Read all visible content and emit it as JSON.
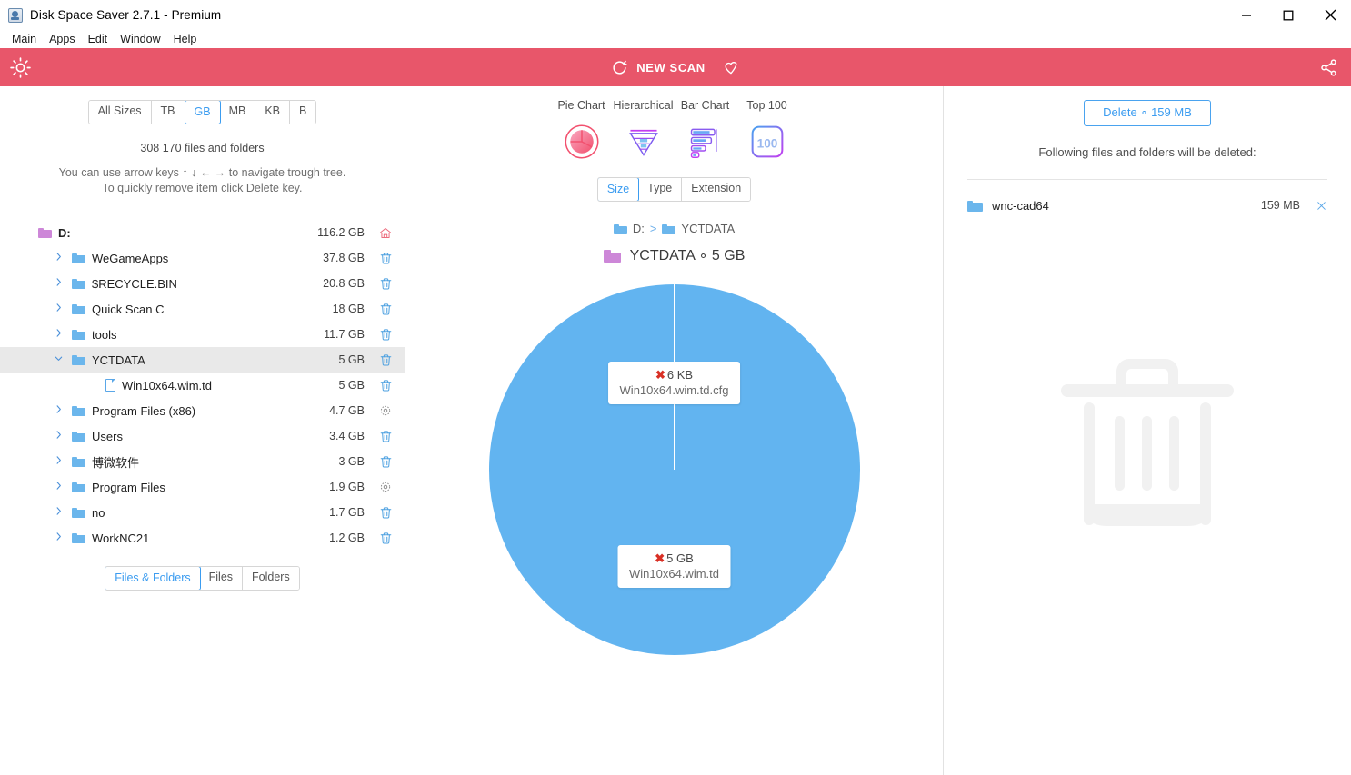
{
  "window": {
    "title": "Disk Space Saver 2.7.1 - Premium",
    "app_icon": "disk-icon",
    "minimize": "minimize-icon",
    "maximize": "maximize-icon",
    "close": "close-icon"
  },
  "menubar": {
    "items": [
      "Main",
      "Apps",
      "Edit",
      "Window",
      "Help"
    ]
  },
  "toolbar": {
    "brightness_icon": "sun-icon",
    "new_scan_label": "NEW SCAN",
    "refresh_icon": "refresh-icon",
    "favorite_icon": "heart-icon",
    "share_icon": "share-icon",
    "bg_color": "#e8566a"
  },
  "left_panel": {
    "size_filter": {
      "options": [
        "All Sizes",
        "TB",
        "GB",
        "MB",
        "KB",
        "B"
      ],
      "selected": "GB"
    },
    "file_count": "308 170 files and folders",
    "hint_line1": "You can use arrow keys ↑ ↓ ← → to navigate trough tree.",
    "hint_line2": "To quickly remove item click Delete key.",
    "tree": [
      {
        "name": "D:",
        "size": "116.2 GB",
        "indent": 0,
        "chevron": "",
        "icon": "folder-purple",
        "action": "home-icon",
        "bold": true,
        "selected": false
      },
      {
        "name": "WeGameApps",
        "size": "37.8 GB",
        "indent": 1,
        "chevron": ">",
        "icon": "folder-blue",
        "action": "trash-icon",
        "bold": false,
        "selected": false
      },
      {
        "name": "$RECYCLE.BIN",
        "size": "20.8 GB",
        "indent": 1,
        "chevron": ">",
        "icon": "folder-blue",
        "action": "trash-icon",
        "bold": false,
        "selected": false
      },
      {
        "name": "Quick Scan C",
        "size": "18 GB",
        "indent": 1,
        "chevron": ">",
        "icon": "folder-blue",
        "action": "trash-icon",
        "bold": false,
        "selected": false
      },
      {
        "name": "tools",
        "size": "11.7 GB",
        "indent": 1,
        "chevron": ">",
        "icon": "folder-blue",
        "action": "trash-icon",
        "bold": false,
        "selected": false
      },
      {
        "name": "YCTDATA",
        "size": "5 GB",
        "indent": 1,
        "chevron": "v",
        "icon": "folder-blue",
        "action": "trash-icon",
        "bold": false,
        "selected": true
      },
      {
        "name": "Win10x64.wim.td",
        "size": "5 GB",
        "indent": 2,
        "chevron": "",
        "icon": "file",
        "action": "trash-icon",
        "bold": false,
        "selected": false
      },
      {
        "name": "Program Files (x86)",
        "size": "4.7 GB",
        "indent": 1,
        "chevron": ">",
        "icon": "folder-blue",
        "action": "gear-icon",
        "bold": false,
        "selected": false
      },
      {
        "name": "Users",
        "size": "3.4 GB",
        "indent": 1,
        "chevron": ">",
        "icon": "folder-blue",
        "action": "trash-icon",
        "bold": false,
        "selected": false
      },
      {
        "name": "博微软件",
        "size": "3 GB",
        "indent": 1,
        "chevron": ">",
        "icon": "folder-blue",
        "action": "trash-icon",
        "bold": false,
        "selected": false
      },
      {
        "name": "Program Files",
        "size": "1.9 GB",
        "indent": 1,
        "chevron": ">",
        "icon": "folder-blue",
        "action": "gear-icon",
        "bold": false,
        "selected": false
      },
      {
        "name": "no",
        "size": "1.7 GB",
        "indent": 1,
        "chevron": ">",
        "icon": "folder-blue",
        "action": "trash-icon",
        "bold": false,
        "selected": false
      },
      {
        "name": "WorkNC21",
        "size": "1.2 GB",
        "indent": 1,
        "chevron": ">",
        "icon": "folder-blue",
        "action": "trash-icon",
        "bold": false,
        "selected": false
      }
    ],
    "view_filter": {
      "options": [
        "Files & Folders",
        "Files",
        "Folders"
      ],
      "selected": "Files & Folders"
    }
  },
  "center_panel": {
    "view_tabs": [
      {
        "label": "Pie Chart",
        "icon": "pie-chart-icon",
        "active": true
      },
      {
        "label": "Hierarchical",
        "icon": "funnel-icon",
        "active": false
      },
      {
        "label": "Bar Chart",
        "icon": "bar-chart-icon",
        "active": false
      },
      {
        "label": "Top 100",
        "icon": "top100-icon",
        "active": false
      }
    ],
    "group_by": {
      "options": [
        "Size",
        "Type",
        "Extension"
      ],
      "selected": "Size"
    },
    "breadcrumb": {
      "items": [
        "D:",
        "YCTDATA"
      ],
      "separator": ">"
    },
    "chart_title": "YCTDATA ∘ 5 GB",
    "chart_data": {
      "type": "pie",
      "title": "YCTDATA ∘ 5 GB",
      "categories": [
        "Win10x64.wim.td",
        "Win10x64.wim.td.cfg"
      ],
      "values": [
        5368709120,
        6144
      ],
      "value_labels": [
        "5 GB",
        "6 KB"
      ],
      "colors": [
        "#62b4f0",
        "#62b4f0"
      ],
      "legend": "none",
      "labels": [
        {
          "size": "5 GB",
          "name": "Win10x64.wim.td",
          "marker": "x-delete-icon"
        },
        {
          "size": "6 KB",
          "name": "Win10x64.wim.td.cfg",
          "marker": "x-delete-icon"
        }
      ]
    }
  },
  "right_panel": {
    "delete_button": "Delete ∘ 159 MB",
    "subtitle": "Following files and folders will be deleted:",
    "items": [
      {
        "name": "wnc-cad64",
        "size": "159 MB",
        "icon": "folder-blue",
        "remove": "close-icon"
      }
    ],
    "background_icon": "trash-icon"
  }
}
